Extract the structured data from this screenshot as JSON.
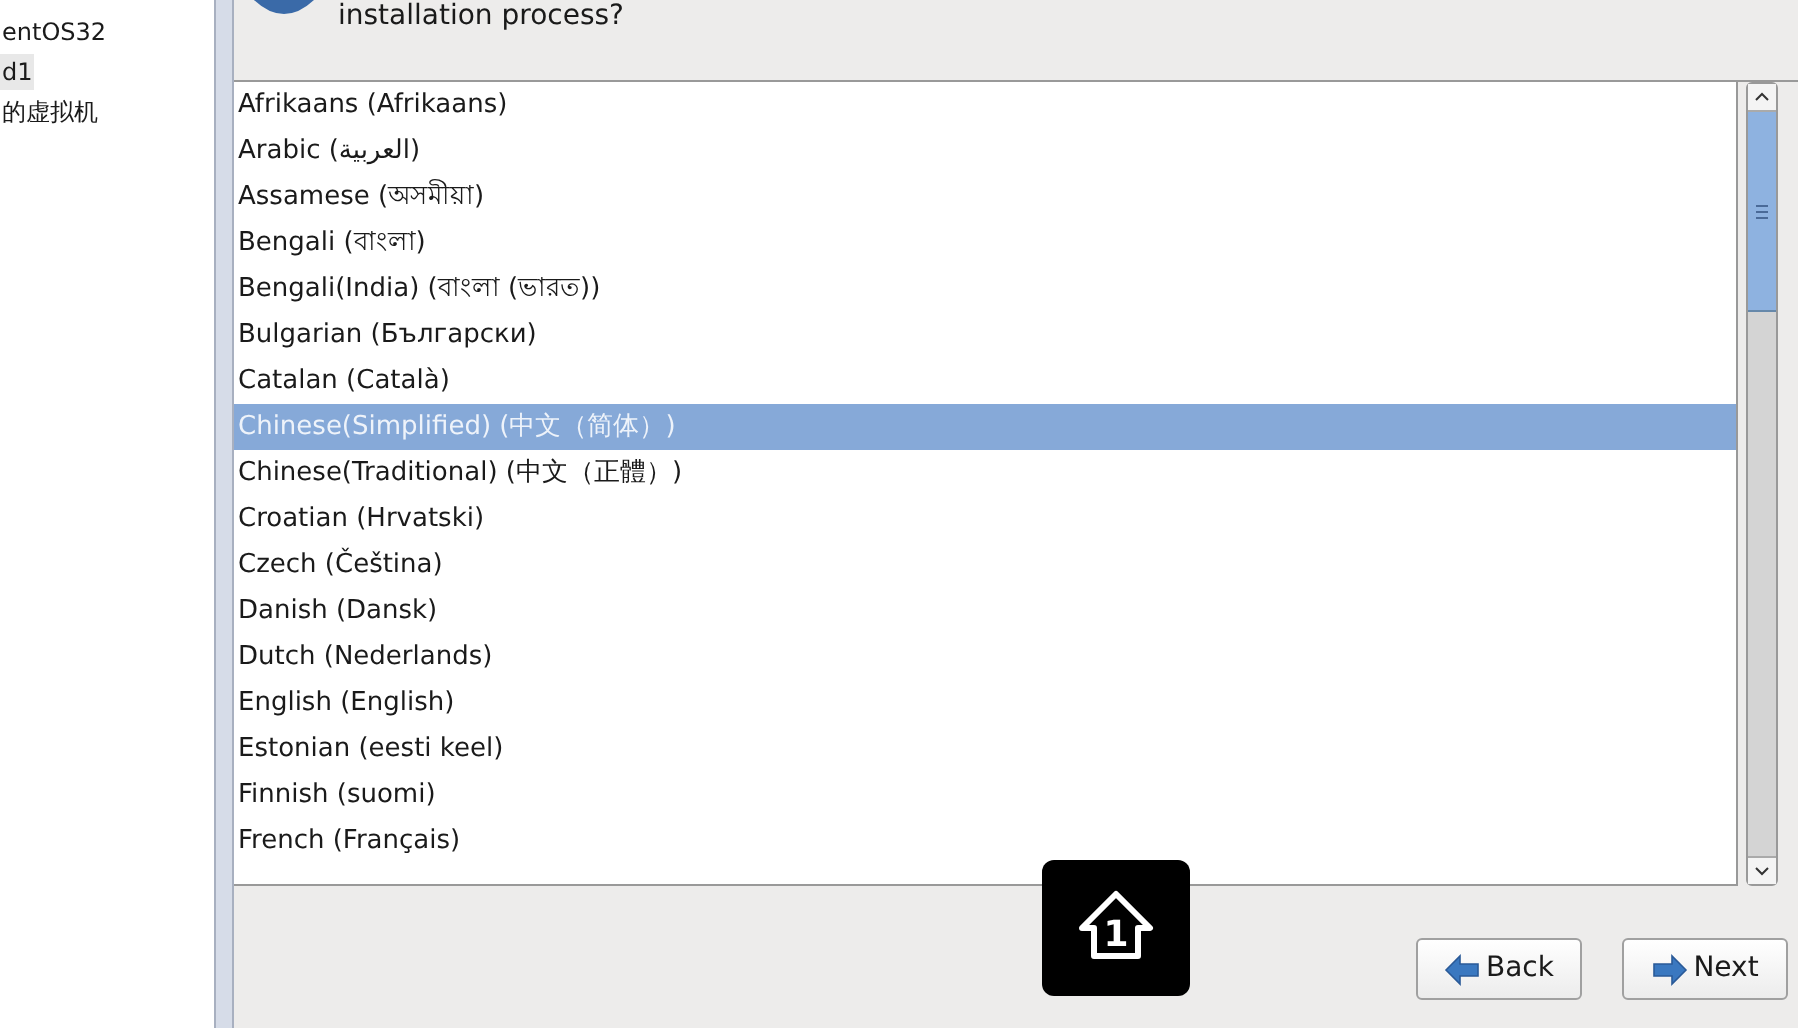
{
  "sidebar": {
    "items": [
      {
        "label": "entOS32",
        "selected": false
      },
      {
        "label": "d1",
        "selected": true
      },
      {
        "label": "的虚拟机",
        "selected": false
      }
    ]
  },
  "header": {
    "text": "installation process?"
  },
  "languages": [
    {
      "label": "Afrikaans (Afrikaans)",
      "selected": false
    },
    {
      "label": "Arabic (العربية)",
      "selected": false
    },
    {
      "label": "Assamese (অসমীয়া)",
      "selected": false
    },
    {
      "label": "Bengali (বাংলা)",
      "selected": false
    },
    {
      "label": "Bengali(India) (বাংলা (ভারত))",
      "selected": false
    },
    {
      "label": "Bulgarian (Български)",
      "selected": false
    },
    {
      "label": "Catalan (Català)",
      "selected": false
    },
    {
      "label": "Chinese(Simplified) (中文（简体）)",
      "selected": true
    },
    {
      "label": "Chinese(Traditional) (中文（正體）)",
      "selected": false
    },
    {
      "label": "Croatian (Hrvatski)",
      "selected": false
    },
    {
      "label": "Czech (Čeština)",
      "selected": false
    },
    {
      "label": "Danish (Dansk)",
      "selected": false
    },
    {
      "label": "Dutch (Nederlands)",
      "selected": false
    },
    {
      "label": "English (English)",
      "selected": false
    },
    {
      "label": "Estonian (eesti keel)",
      "selected": false
    },
    {
      "label": "Finnish (suomi)",
      "selected": false
    },
    {
      "label": "French (Français)",
      "selected": false
    }
  ],
  "buttons": [
    {
      "label": "Back",
      "kind": "back"
    },
    {
      "label": "Next",
      "kind": "next"
    }
  ],
  "overlay_badge": {
    "label": "1"
  }
}
